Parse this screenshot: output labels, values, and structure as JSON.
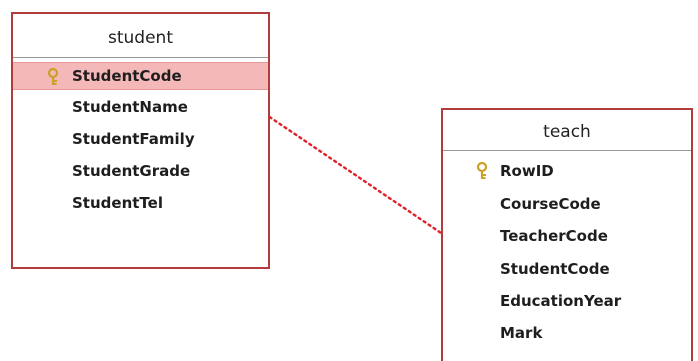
{
  "diagram": {
    "tables": [
      {
        "id": "student",
        "title": "student",
        "fields": [
          {
            "name": "StudentCode",
            "primary_key": true,
            "selected": true
          },
          {
            "name": "StudentName",
            "primary_key": false,
            "selected": false
          },
          {
            "name": "StudentFamily",
            "primary_key": false,
            "selected": false
          },
          {
            "name": "StudentGrade",
            "primary_key": false,
            "selected": false
          },
          {
            "name": "StudentTel",
            "primary_key": false,
            "selected": false
          }
        ]
      },
      {
        "id": "teach",
        "title": "teach",
        "fields": [
          {
            "name": "RowID",
            "primary_key": true,
            "selected": false
          },
          {
            "name": "CourseCode",
            "primary_key": false,
            "selected": false
          },
          {
            "name": "TeacherCode",
            "primary_key": false,
            "selected": false
          },
          {
            "name": "StudentCode",
            "primary_key": false,
            "selected": false
          },
          {
            "name": "EducationYear",
            "primary_key": false,
            "selected": false
          },
          {
            "name": "Mark",
            "primary_key": false,
            "selected": false
          }
        ]
      }
    ],
    "relationships": [
      {
        "from_table": "student",
        "from_field": "StudentCode",
        "to_table": "teach",
        "to_field": "StudentCode",
        "style": "dotted"
      }
    ],
    "colors": {
      "table_border": "#b23b3b",
      "selected_row": "#f4b8b8",
      "relation_line": "#e0202a",
      "key_icon": "#c9a227"
    },
    "icons": {
      "primary_key": "key-icon"
    }
  }
}
